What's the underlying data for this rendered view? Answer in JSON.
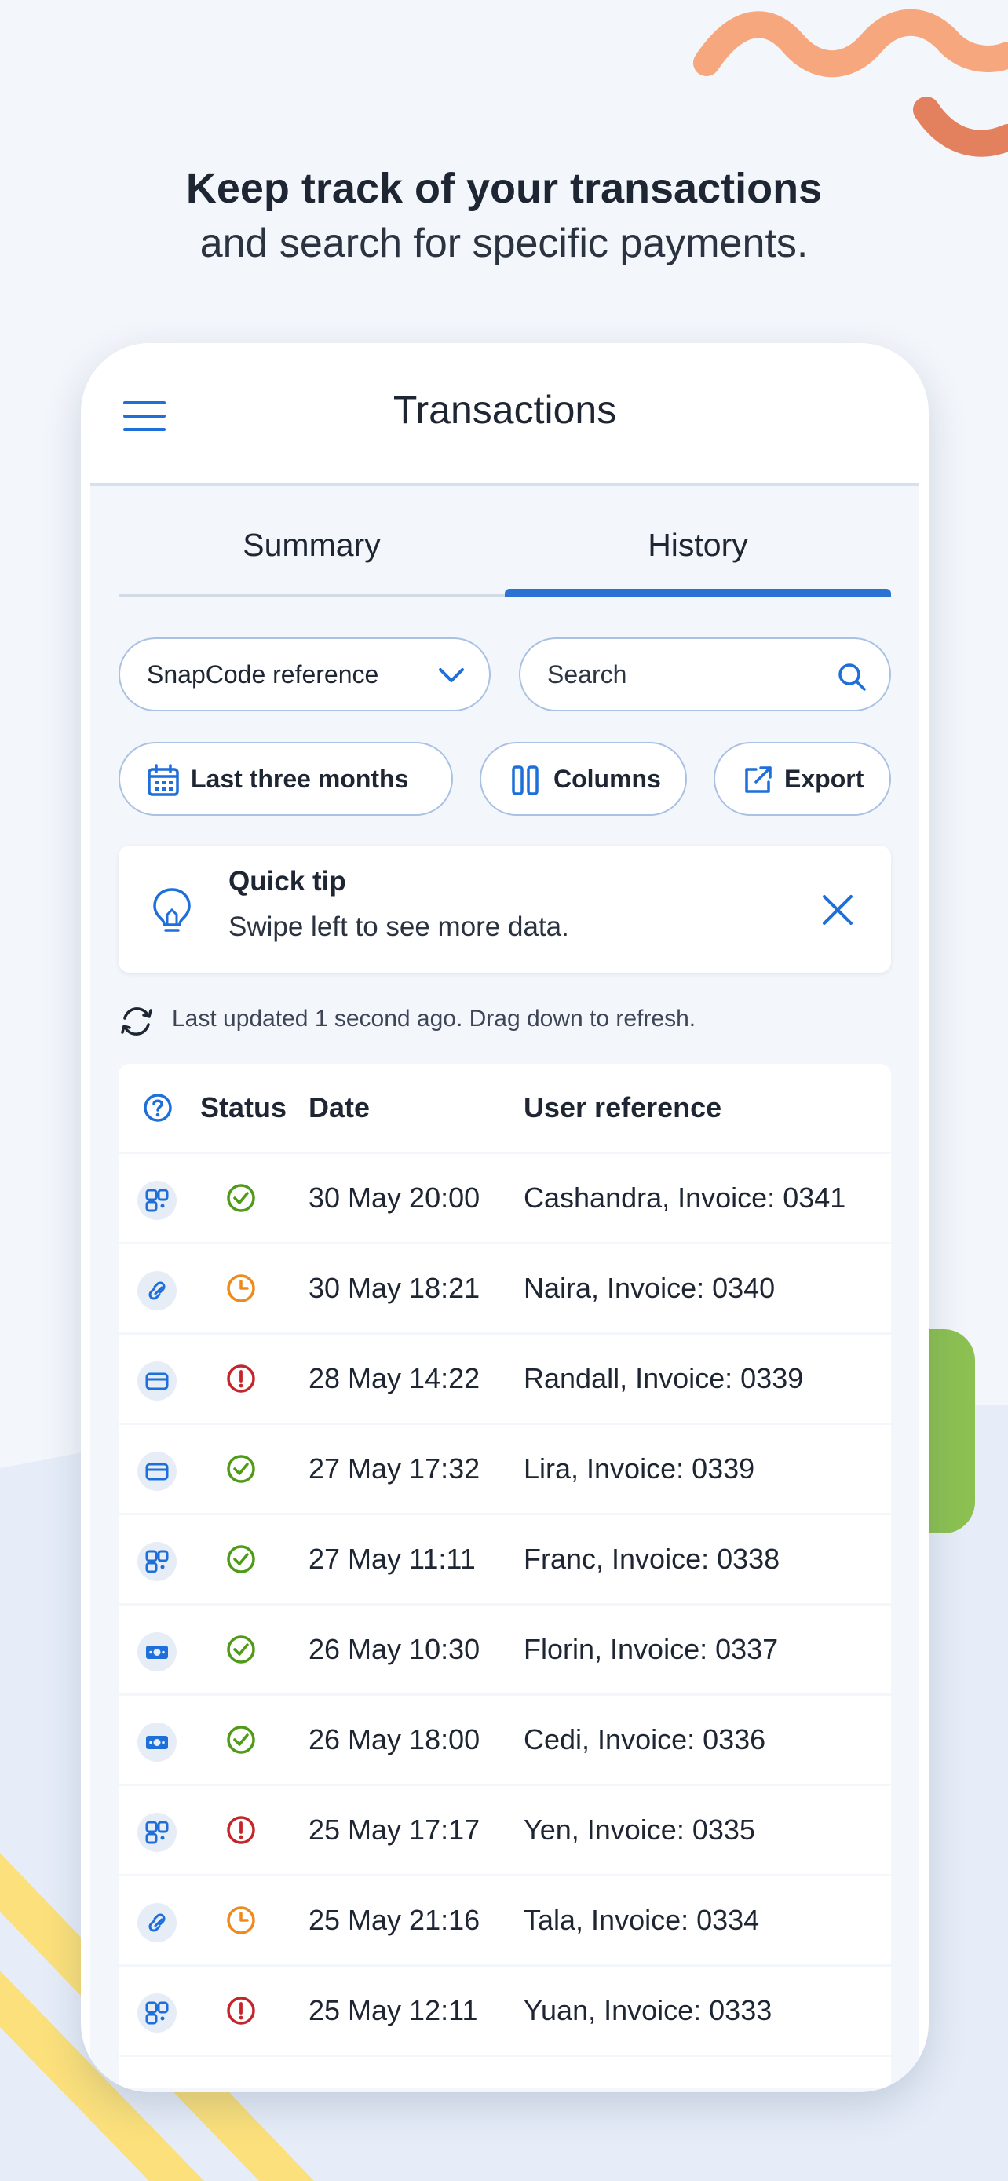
{
  "headline": {
    "line1": "Keep track of your transactions",
    "line2": "and search for specific payments."
  },
  "appbar": {
    "title": "Transactions"
  },
  "tabs": [
    {
      "label": "Summary",
      "active": false
    },
    {
      "label": "History",
      "active": true
    }
  ],
  "filters": {
    "reference_select": "SnapCode reference",
    "search_placeholder": "Search",
    "date_range": "Last three months",
    "columns_label": "Columns",
    "export_label": "Export"
  },
  "quick_tip": {
    "title": "Quick tip",
    "text": "Swipe left to see more data."
  },
  "updated_text": "Last updated 1 second ago. Drag down to refresh.",
  "table": {
    "headers": [
      "Status",
      "Date",
      "User reference"
    ],
    "rows": [
      {
        "type": "snapcode",
        "status": "success",
        "date": "30 May 20:00",
        "ref": "Cashandra, Invoice: 0341"
      },
      {
        "type": "link",
        "status": "pending",
        "date": "30 May 18:21",
        "ref": "Naira, Invoice: 0340"
      },
      {
        "type": "card",
        "status": "error",
        "date": "28 May 14:22",
        "ref": "Randall, Invoice: 0339"
      },
      {
        "type": "card",
        "status": "success",
        "date": "27 May 17:32",
        "ref": "Lira, Invoice: 0339"
      },
      {
        "type": "snapcode",
        "status": "success",
        "date": "27 May 11:11",
        "ref": "Franc, Invoice: 0338"
      },
      {
        "type": "cash",
        "status": "success",
        "date": "26 May 10:30",
        "ref": "Florin, Invoice: 0337"
      },
      {
        "type": "cash",
        "status": "success",
        "date": "26 May 18:00",
        "ref": "Cedi, Invoice: 0336"
      },
      {
        "type": "snapcode",
        "status": "error",
        "date": "25 May 17:17",
        "ref": "Yen, Invoice: 0335"
      },
      {
        "type": "link",
        "status": "pending",
        "date": "25 May 21:16",
        "ref": "Tala, Invoice: 0334"
      },
      {
        "type": "snapcode",
        "status": "error",
        "date": "25 May 12:11",
        "ref": "Yuan, Invoice: 0333"
      }
    ]
  },
  "colors": {
    "accent": "#2a73d3",
    "success": "#4f9a16",
    "pending": "#ee8a1c",
    "error": "#c3252b"
  }
}
